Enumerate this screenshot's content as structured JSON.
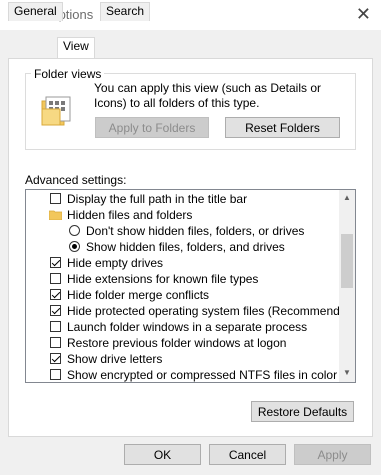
{
  "window": {
    "title": "Folder Options",
    "close_glyph": "✕"
  },
  "tabs": [
    {
      "label": "General",
      "active": false
    },
    {
      "label": "View",
      "active": true
    },
    {
      "label": "Search",
      "active": false
    }
  ],
  "folder_views": {
    "label": "Folder views",
    "description": "You can apply this view (such as Details or Icons) to all folders of this type.",
    "apply_label": "Apply to Folders",
    "reset_label": "Reset Folders"
  },
  "advanced": {
    "label": "Advanced settings:",
    "items": [
      {
        "type": "checkbox",
        "checked": false,
        "label": "Display the full path in the title bar"
      },
      {
        "type": "folder",
        "label": "Hidden files and folders"
      },
      {
        "type": "radio",
        "selected": false,
        "label": "Don't show hidden files, folders, or drives"
      },
      {
        "type": "radio",
        "selected": true,
        "label": "Show hidden files, folders, and drives"
      },
      {
        "type": "checkbox",
        "checked": true,
        "label": "Hide empty drives"
      },
      {
        "type": "checkbox",
        "checked": false,
        "label": "Hide extensions for known file types"
      },
      {
        "type": "checkbox",
        "checked": true,
        "label": "Hide folder merge conflicts"
      },
      {
        "type": "checkbox",
        "checked": true,
        "label": "Hide protected operating system files (Recommended)"
      },
      {
        "type": "checkbox",
        "checked": false,
        "label": "Launch folder windows in a separate process"
      },
      {
        "type": "checkbox",
        "checked": false,
        "label": "Restore previous folder windows at logon"
      },
      {
        "type": "checkbox",
        "checked": true,
        "label": "Show drive letters"
      },
      {
        "type": "checkbox",
        "checked": false,
        "label": "Show encrypted or compressed NTFS files in color"
      }
    ],
    "scrollbar": {
      "up_glyph": "▲",
      "down_glyph": "▼"
    }
  },
  "buttons": {
    "restore_defaults": "Restore Defaults",
    "ok": "OK",
    "cancel": "Cancel",
    "apply": "Apply"
  }
}
